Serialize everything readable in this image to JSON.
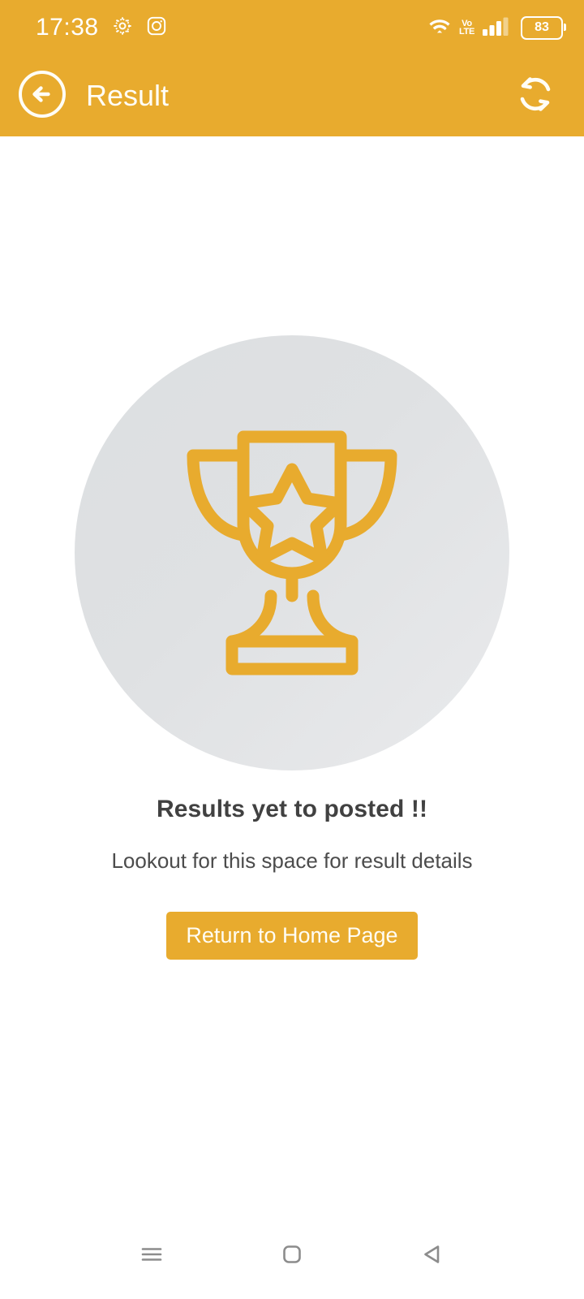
{
  "status_bar": {
    "time": "17:38",
    "left_icons": [
      "gear-icon",
      "instagram-icon"
    ],
    "right_icons": [
      "wifi-icon",
      "volte-icon",
      "signal-bars-icon"
    ],
    "volte_top": "Vo",
    "volte_bottom": "LTE",
    "battery_percent": "83"
  },
  "app_bar": {
    "back_icon": "back-arrow-circle-icon",
    "title": "Result",
    "refresh_icon": "refresh-icon"
  },
  "main": {
    "hero_icon": "trophy-icon",
    "headline": "Results yet to posted !!",
    "subtext": "Lookout for this space for result details",
    "primary_button_label": "Return to Home Page"
  },
  "nav_bar": {
    "recents_icon": "menu-recents-icon",
    "home_icon": "home-square-icon",
    "back_icon": "back-triangle-icon"
  },
  "colors": {
    "accent": "#E8AB2E",
    "header_text": "#FFFFFF",
    "headline_text": "#414141",
    "sub_text": "#4C4C4C",
    "circle_bg": "#DFE1E3",
    "page_bg": "#FFFFFF"
  }
}
